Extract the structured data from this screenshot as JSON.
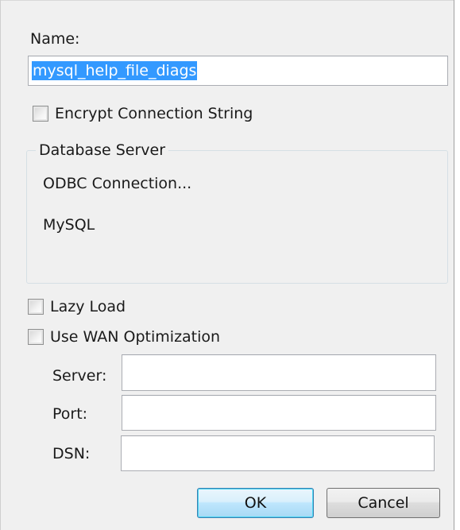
{
  "dialog": {
    "name_label": "Name:",
    "name_value": "mysql_help_file_diags",
    "encrypt_label": "Encrypt Connection String",
    "database_server": {
      "legend": "Database Server",
      "connection_type": "ODBC Connection...",
      "server_type": "MySQL"
    },
    "lazy_load_label": "Lazy Load",
    "wan_label": "Use WAN Optimization",
    "server_label": "Server:",
    "server_value": "",
    "port_label": "Port:",
    "port_value": "",
    "dsn_label": "DSN:",
    "dsn_value": "",
    "ok_label": "OK",
    "cancel_label": "Cancel"
  },
  "colors": {
    "selection_highlight": "#3399ff",
    "ok_button_accent": "#a7d9f5",
    "dialog_background": "#f0f0f0"
  },
  "checkboxes": {
    "encrypt_connection_string": false,
    "lazy_load": false,
    "use_wan_optimization": false
  }
}
